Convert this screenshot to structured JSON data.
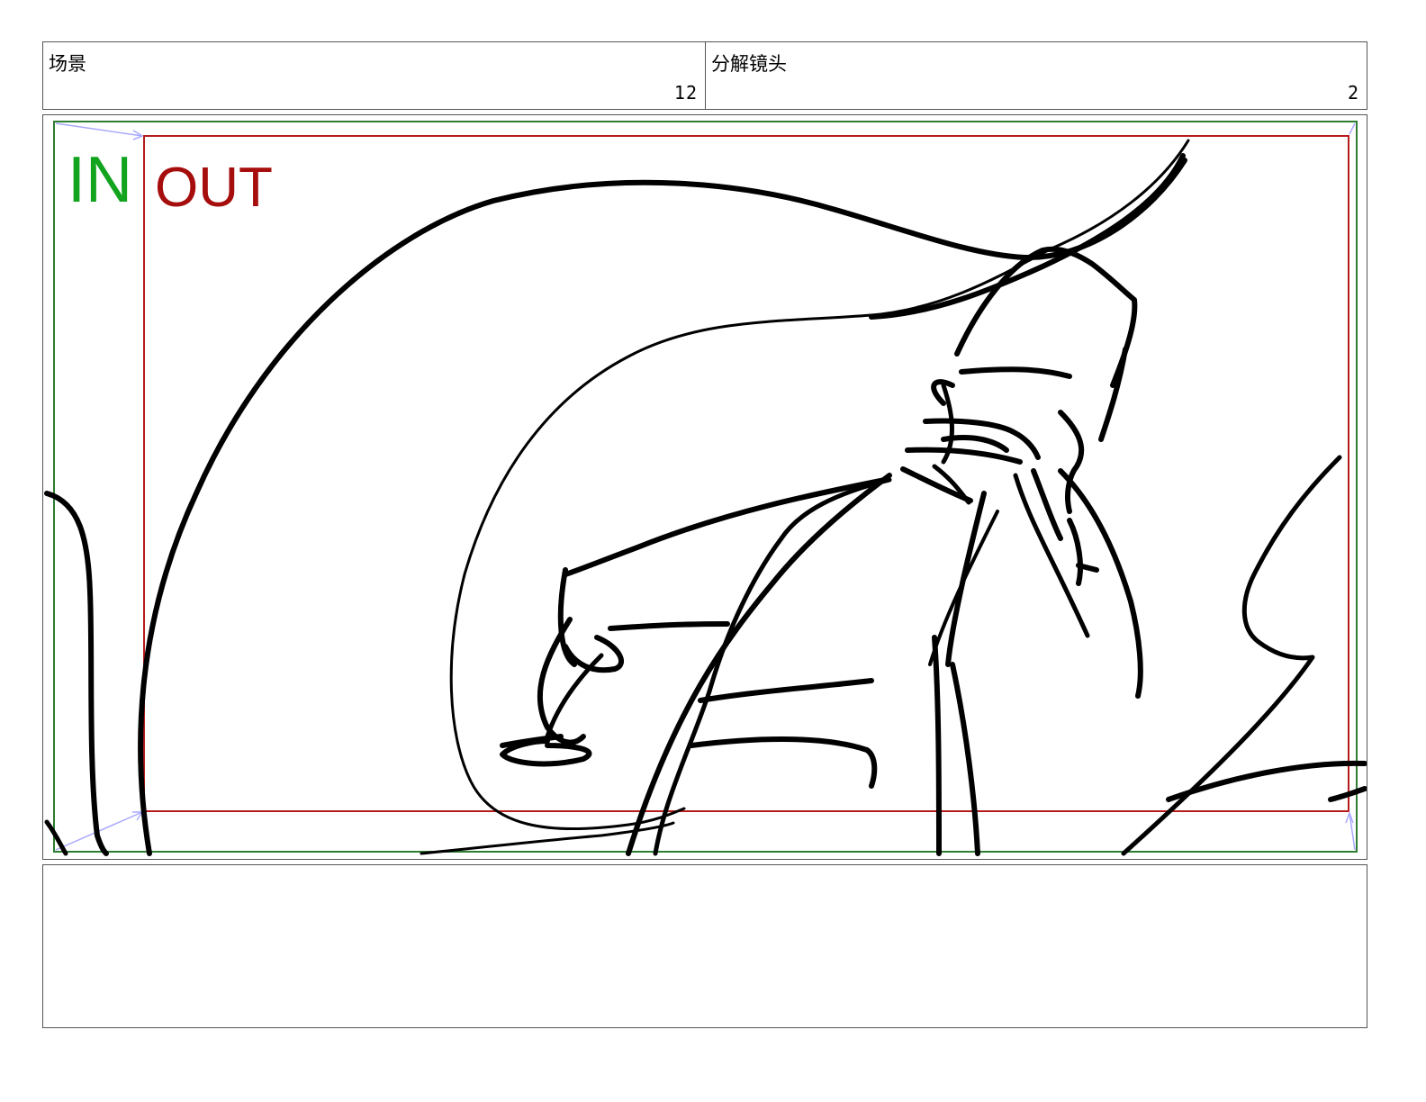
{
  "header": {
    "scene_label": "场景",
    "scene_number": "12",
    "shot_label": "分解镜头",
    "shot_number": "2"
  },
  "panel": {
    "in_label": "IN",
    "out_label": "OUT",
    "colors": {
      "in_frame": "#2e7d32",
      "out_frame": "#b71c1c",
      "in_text": "#12a41e",
      "out_text": "#a60d0d",
      "arrow": "#a9a9ff",
      "ink": "#000000"
    },
    "drawing": "sketch-character-hand"
  },
  "notes": {
    "text": ""
  }
}
